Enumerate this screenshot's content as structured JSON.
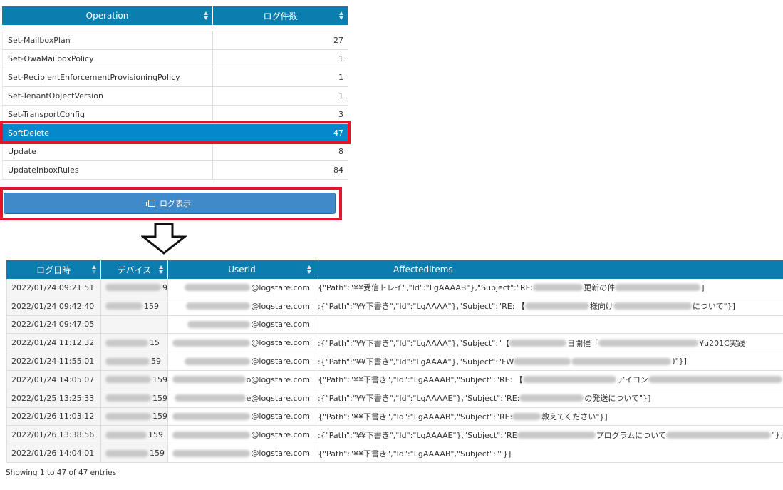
{
  "top_table": {
    "headers": [
      "Operation",
      "ログ件数"
    ],
    "rows": [
      {
        "operation": "Set-MailboxPlan",
        "count": "27"
      },
      {
        "operation": "Set-OwaMailboxPolicy",
        "count": "1"
      },
      {
        "operation": "Set-RecipientEnforcementProvisioningPolicy",
        "count": "1"
      },
      {
        "operation": "Set-TenantObjectVersion",
        "count": "1"
      },
      {
        "operation": "Set-TransportConfig",
        "count": "3"
      },
      {
        "operation": "SoftDelete",
        "count": "47"
      },
      {
        "operation": "Update",
        "count": "8"
      },
      {
        "operation": "UpdateInboxRules",
        "count": "84"
      }
    ],
    "selected_operation": "SoftDelete"
  },
  "button": {
    "label": "ログ表示",
    "icon": "list-icon"
  },
  "arrow_icon": "down-arrow-outline-icon",
  "bottom_table": {
    "headers": [
      "ログ日時",
      "デバイス",
      "UserId",
      "AffectedItems"
    ],
    "rows": [
      {
        "date": "2022/01/24 09:21:51",
        "device": "9",
        "user": "@logstare.com",
        "items": "{\"Path\":\"¥¥受信トレイ\",\"Id\":\"LgAAAAB\"},\"Subject\":\"RE:",
        "items_mid": "更新の件",
        "items_tail": "]"
      },
      {
        "date": "2022/01/24 09:42:40",
        "device": "159",
        "user": "@logstare.com",
        "items": ":{\"Path\":\"¥¥下書き\",\"Id\":\"LgAAAA\"},\"Subject\":\"RE: 【",
        "items_mid": "様向け",
        "items_tail": "について\"}]"
      },
      {
        "date": "2022/01/24 09:47:05",
        "device": "",
        "user": "@logstare.com",
        "items": "",
        "items_mid": "",
        "items_tail": ""
      },
      {
        "date": "2022/01/24 11:12:32",
        "device": "15",
        "user": "@logstare.com",
        "items": ":{\"Path\":\"¥¥下書き\",\"Id\":\"LgAAAA\"},\"Subject\":\"【",
        "items_mid": "日開催「",
        "items_tail": "¥u201C実践"
      },
      {
        "date": "2022/01/24 11:55:01",
        "device": "59",
        "user": "@logstare.com",
        "items": ":{\"Path\":\"¥¥下書き\",\"Id\":\"LgAAAA\"},\"Subject\":\"FW",
        "items_mid": "",
        "items_tail": ")\"}]"
      },
      {
        "date": "2022/01/24 14:05:07",
        "device": "159",
        "user": "o@logstare.com",
        "items": "{\"Path\":\"¥¥下書き\",\"Id\":\"LgAAAAB\",\"Subject\":\"RE: 【",
        "items_mid": "アイコン",
        "items_tail": ""
      },
      {
        "date": "2022/01/25 13:25:33",
        "device": "159",
        "user": "e@logstare.com",
        "items": ":{\"Path\":\"¥¥下書き\",\"Id\":\"LgAAAAE\"},\"Subject\":\"RE:",
        "items_mid": "の発送について\"}]",
        "items_tail": ""
      },
      {
        "date": "2022/01/26 11:03:12",
        "device": "159",
        "user": "@logstare.com",
        "items": "{\"Path\":\"¥¥下書き\",\"Id\":\"LgAAAAB\",\"Subject\":\"RE:",
        "items_mid": "教えてください\"}]",
        "items_tail": ""
      },
      {
        "date": "2022/01/26 13:38:56",
        "device": "159",
        "user": "@logstare.com",
        "items": ":{\"Path\":\"¥¥下書き\",\"Id\":\"LgAAAAE\"},\"Subject\":\"RE",
        "items_mid": "プログラムについて",
        "items_tail": "\"}]"
      },
      {
        "date": "2022/01/26 14:04:01",
        "device": "159",
        "user": "@logstare.com",
        "items": "{\"Path\":\"¥¥下書き\",\"Id\":\"LgAAAAB\",\"Subject\":\"\"}]",
        "items_mid": "",
        "items_tail": ""
      }
    ]
  },
  "footer": {
    "info": "Showing 1 to 47 of 47 entries"
  },
  "colors": {
    "header": "#0b7dae",
    "selected": "#0688cc",
    "button": "#418ac9",
    "highlight": "#e4142a"
  }
}
